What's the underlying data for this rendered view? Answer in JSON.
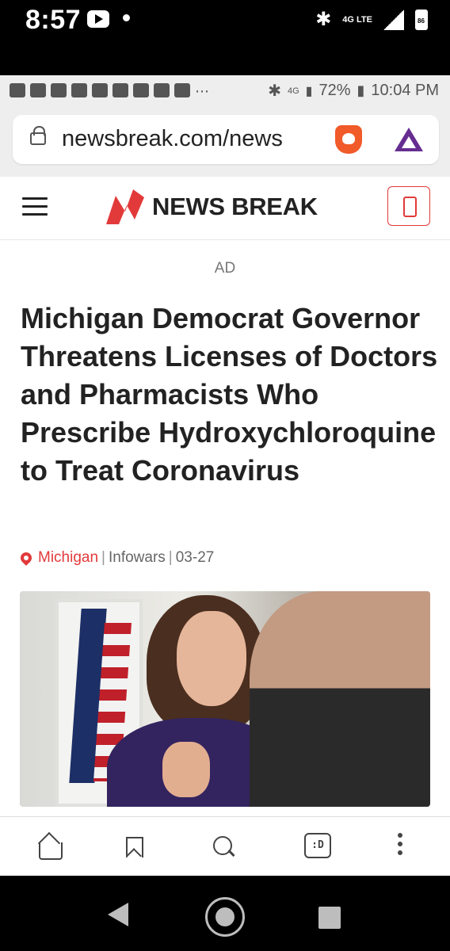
{
  "device_status": {
    "time": "8:57",
    "network": "4G LTE"
  },
  "screenshot_status": {
    "network": "4G",
    "battery": "72%",
    "time": "10:04 PM"
  },
  "browser": {
    "url": "newsbreak.com/news",
    "bottom_tabs_label": ":D"
  },
  "site": {
    "brand": "NEWS BREAK",
    "brand_color": "#e23a3a"
  },
  "article": {
    "ad_label": "AD",
    "headline": "Michigan Democrat Governor Threatens Licenses of Doctors and Pharmacists Who Prescribe Hydroxychloroquine to Treat Coronavirus",
    "location": "Michigan",
    "source": "Infowars",
    "date": "03-27"
  },
  "icons": [
    "lock-icon",
    "brave-lion-icon",
    "bat-icon",
    "hamburger-icon",
    "app-icon",
    "location-pin-icon",
    "home-icon",
    "bookmark-icon",
    "search-icon",
    "tabs-icon",
    "more-icon",
    "back-icon",
    "circle-home-icon",
    "recents-icon"
  ]
}
